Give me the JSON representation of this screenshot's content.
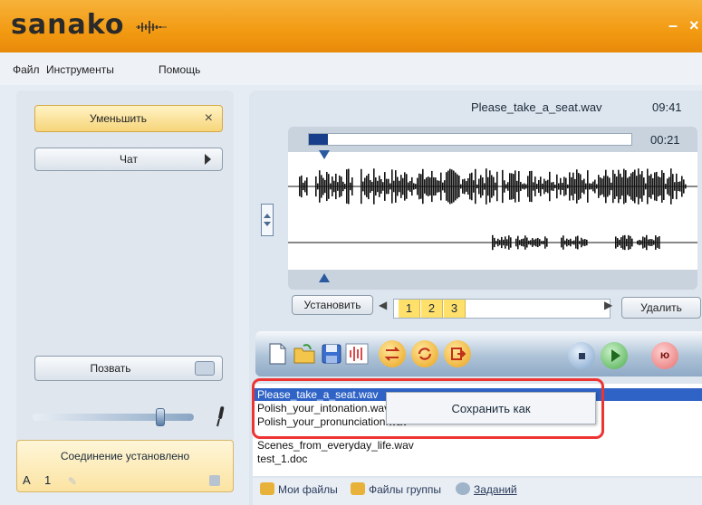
{
  "app": {
    "logo": "sanako"
  },
  "window_controls": {
    "minimize": "–",
    "close": "×"
  },
  "menu": [
    "Файл",
    "Инструменты",
    "Помощь"
  ],
  "left_panel": {
    "minimize_button": "Уменьшить",
    "minimize_close": "×",
    "chat_button": "Чат",
    "call_button": "Позвать",
    "status": "Соединение установлено",
    "status_letter": "A",
    "status_number": "1"
  },
  "player": {
    "filename": "Please_take_a_seat.wav",
    "duration": "09:41",
    "position": "00:21",
    "progress": 0.06,
    "set_button": "Установить",
    "pages": [
      "1",
      "2",
      "3"
    ],
    "delete_button": "Удалить"
  },
  "toolbar": {
    "record_label": "ю"
  },
  "files": {
    "items": [
      "Please_take_a_seat.wav",
      "Polish_your_intonation.wav",
      "Polish_your_pronunciation.wav",
      "Scenes_from_everyday_life.wav",
      "test_1.doc"
    ],
    "selected_index": 0
  },
  "context_menu": {
    "save_as": "Сохранить как"
  },
  "tabs": [
    "Мои файлы",
    "Файлы группы",
    "Заданий"
  ],
  "colors": {
    "title_bar": "#f29a12",
    "selection": "#2f63c6",
    "highlight": "#e33333"
  }
}
